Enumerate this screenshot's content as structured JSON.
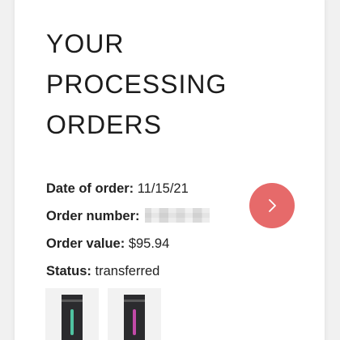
{
  "title_lines": [
    "YOUR",
    "PROCESSING",
    "ORDERS"
  ],
  "order": {
    "date_label": "Date of order:",
    "date_value": "11/15/21",
    "number_label": "Order number:",
    "value_label": "Order value:",
    "value_value": "$95.94",
    "status_label": "Status:",
    "status_value": "transferred"
  },
  "colors": {
    "accent_button": "#e66a6a",
    "vial_1": "#4fc3a1",
    "vial_2": "#c24aa8"
  },
  "icons": {
    "open_order": "chevron-right-icon"
  }
}
